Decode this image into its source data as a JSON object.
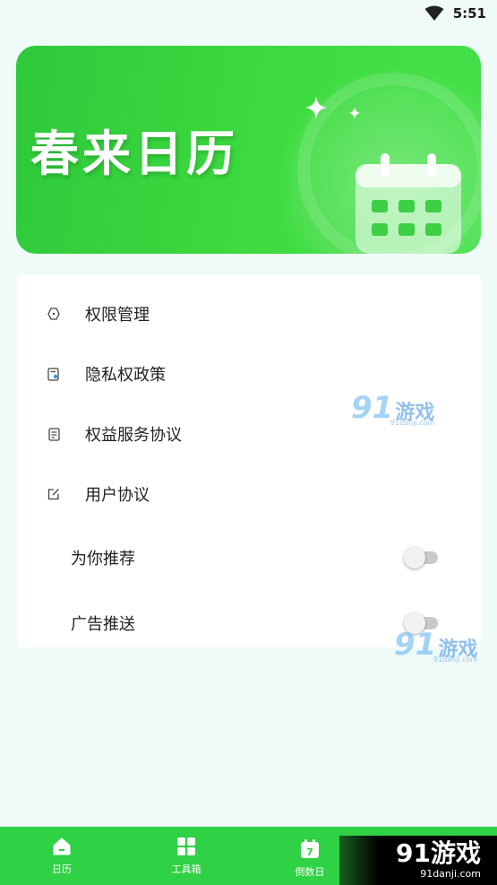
{
  "status_bar": {
    "time": "5:51"
  },
  "banner": {
    "title": "春来日历"
  },
  "menu": {
    "items": [
      {
        "label": "权限管理",
        "icon": "hexagon-icon"
      },
      {
        "label": "隐私权政策",
        "icon": "privacy-doc-icon"
      },
      {
        "label": "权益服务协议",
        "icon": "document-icon"
      },
      {
        "label": "用户协议",
        "icon": "edit-doc-icon"
      }
    ],
    "toggles": [
      {
        "label": "为你推荐",
        "on": false
      },
      {
        "label": "广告推送",
        "on": false
      }
    ]
  },
  "watermark": {
    "num": "91",
    "text": "游戏",
    "site": "91danji.com"
  },
  "nav": {
    "items": [
      {
        "label": "日历",
        "icon": "home-icon"
      },
      {
        "label": "工具箱",
        "icon": "grid-icon"
      },
      {
        "label": "倒数日",
        "icon": "calendar-7-icon",
        "badge": "7"
      }
    ]
  },
  "colors": {
    "accent": "#2fd145",
    "banner": "#3ddb3f"
  }
}
